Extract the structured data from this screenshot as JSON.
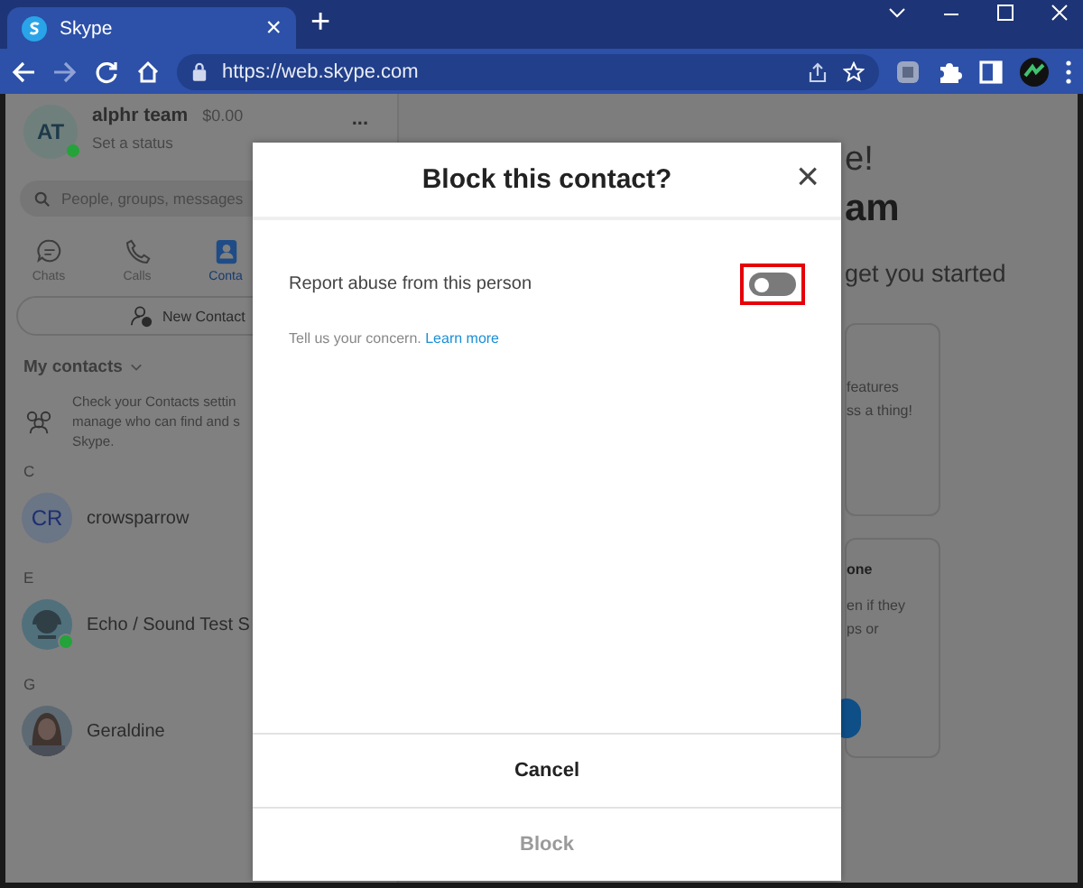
{
  "browser": {
    "tab_title": "Skype",
    "tab_close": "×",
    "new_tab": "+",
    "url": "https://web.skype.com"
  },
  "profile": {
    "initials": "AT",
    "name": "alphr team",
    "balance": "$0.00",
    "status": "Set a status",
    "online": true,
    "more": "..."
  },
  "search": {
    "placeholder": "People, groups, messages"
  },
  "nav_tabs": [
    {
      "kind": "chat",
      "label": "Chats",
      "selected": false
    },
    {
      "kind": "call",
      "label": "Calls",
      "selected": false
    },
    {
      "kind": "contact",
      "label": "Conta",
      "selected": true
    }
  ],
  "new_contact": "New Contact",
  "section_title": "My contacts",
  "contacts_tip": [
    "Check your Contacts settin",
    "manage who can find and s",
    "Skype."
  ],
  "contact_groups": [
    {
      "letter": "C",
      "contacts": [
        {
          "kind": "initials",
          "initials": "CR",
          "name": "crowsparrow",
          "online": false
        }
      ]
    },
    {
      "letter": "E",
      "contacts": [
        {
          "kind": "bot",
          "name": "Echo / Sound Test S",
          "online": true
        }
      ]
    },
    {
      "letter": "G",
      "contacts": [
        {
          "kind": "picture",
          "name": "Geraldine",
          "online": false
        }
      ]
    }
  ],
  "main": {
    "greeting": "e!",
    "name": "am",
    "subtitle": "get you started",
    "cards": [
      {
        "lines": [
          "features",
          "ss a thing!"
        ]
      },
      {
        "title": "one",
        "lines": [
          "en if they",
          "ps or"
        ]
      }
    ]
  },
  "dialog": {
    "title": "Block this contact?",
    "close": "×",
    "option": {
      "label": "Report abuse from this person",
      "on": false,
      "highlighted": true
    },
    "hint": "Tell us your concern.",
    "link": "Learn more",
    "buttons": [
      {
        "label": "Cancel",
        "disabled": false
      },
      {
        "label": "Block",
        "disabled": true
      }
    ]
  }
}
